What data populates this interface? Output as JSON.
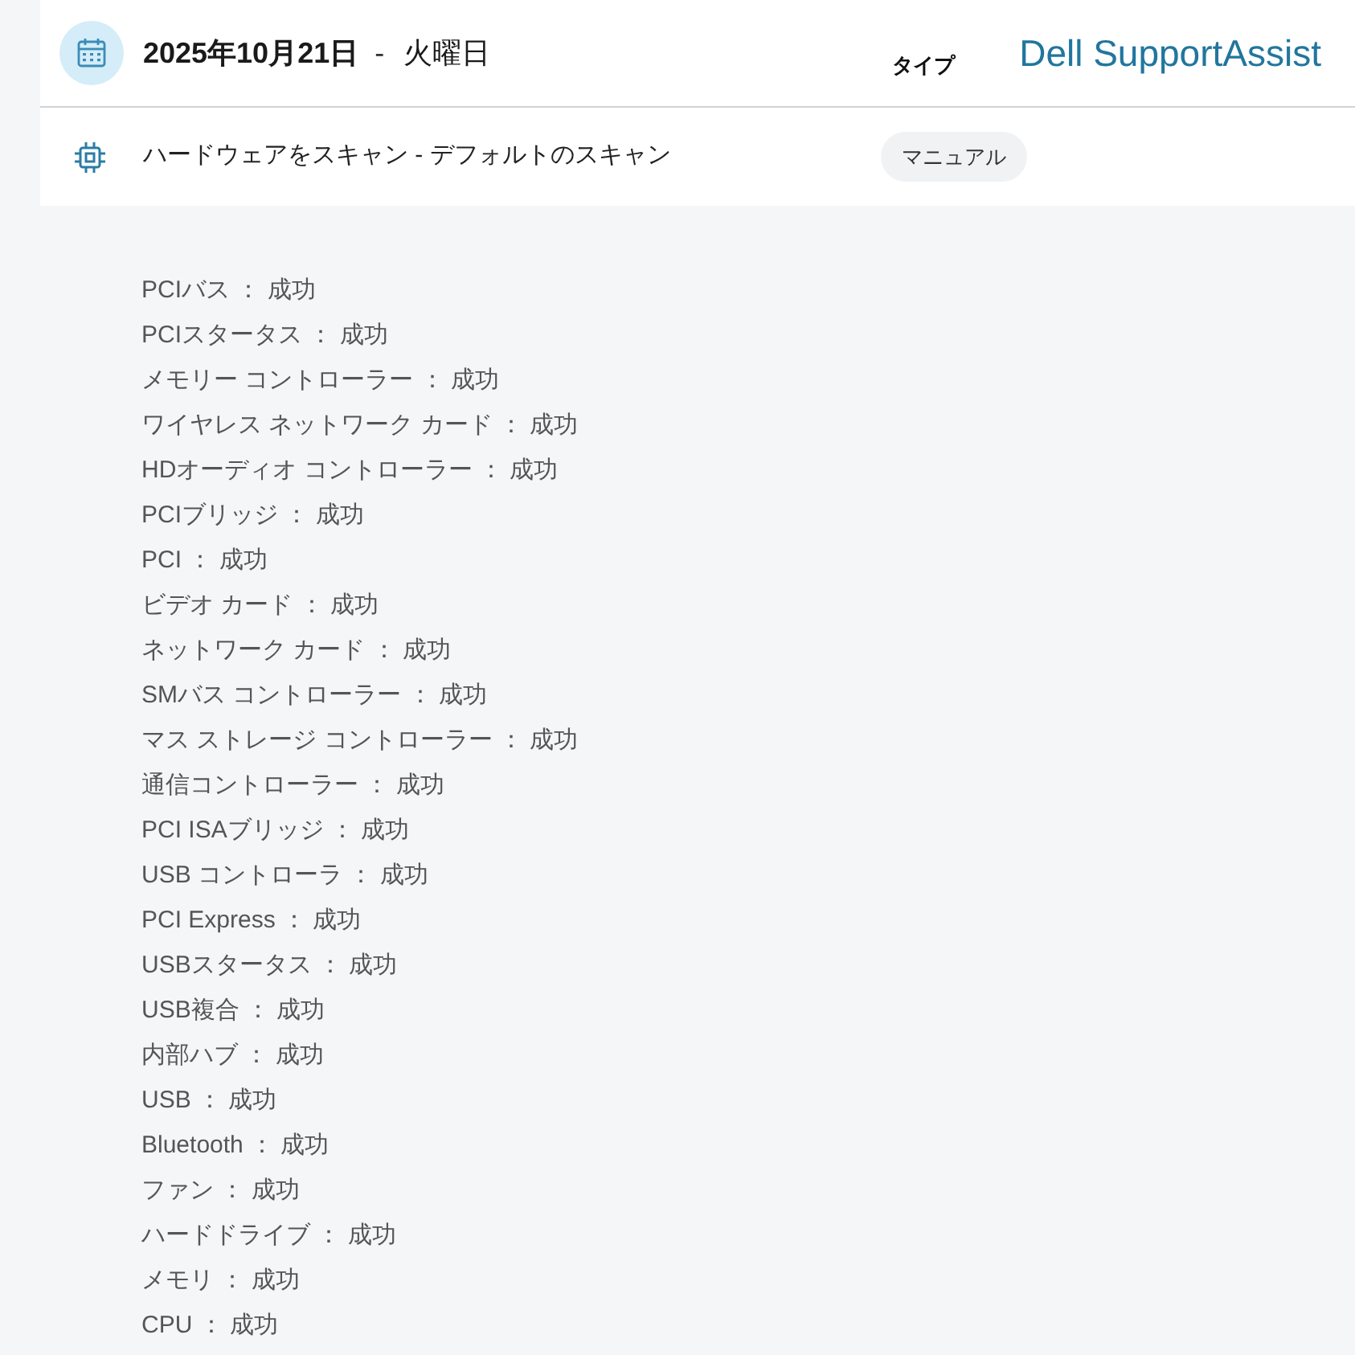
{
  "header": {
    "date": "2025年10月21日",
    "separator": "-",
    "weekday": "火曜日",
    "type_label": "タイプ",
    "brand": "Dell SupportAssist"
  },
  "scan": {
    "name": "ハードウェアをスキャン - デフォルトのスキャン",
    "type": "マニュアル"
  },
  "results": [
    "PCIバス ： 成功",
    "PCIスタータス ： 成功",
    "メモリー コントローラー ： 成功",
    "ワイヤレス ネットワーク カード ： 成功",
    "HDオーディオ コントローラー ： 成功",
    "PCIブリッジ ： 成功",
    "PCI ： 成功",
    "ビデオ カード ： 成功",
    "ネットワーク カード ： 成功",
    "SMバス コントローラー ： 成功",
    "マス ストレージ コントローラー ： 成功",
    "通信コントローラー ： 成功",
    "PCI ISAブリッジ ： 成功",
    "USB コントローラ ： 成功",
    "PCI Express ： 成功",
    "USBスタータス ： 成功",
    "USB複合 ： 成功",
    "内部ハブ ： 成功",
    "USB ： 成功",
    "Bluetooth ： 成功",
    "ファン ： 成功",
    "ハードドライブ ： 成功",
    "メモリ ： 成功",
    "CPU ： 成功"
  ]
}
